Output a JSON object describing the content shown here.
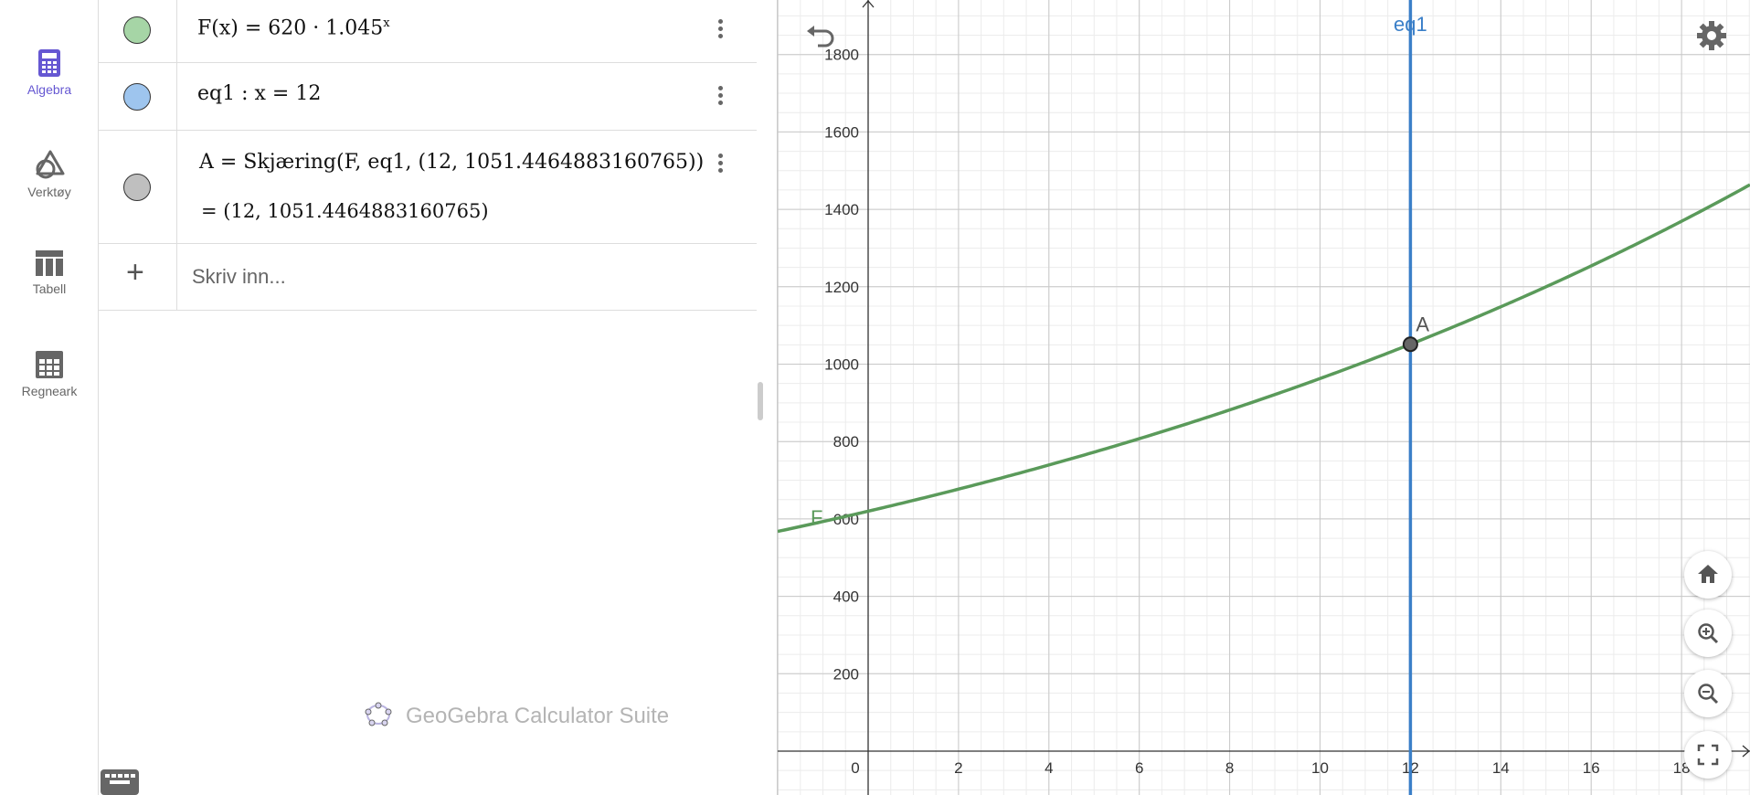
{
  "rail": {
    "items": [
      {
        "label": "Algebra",
        "icon": "calculator-icon",
        "active": true
      },
      {
        "label": "Verktøy",
        "icon": "tools-icon",
        "active": false
      },
      {
        "label": "Tabell",
        "icon": "table-icon",
        "active": false
      },
      {
        "label": "Regneark",
        "icon": "spreadsheet-icon",
        "active": false
      }
    ]
  },
  "algebra": {
    "rows": [
      {
        "text": "F(x)  =  620 · 1.045",
        "sup": "x",
        "color": "#a6d5a6"
      },
      {
        "text": "eq1 : x  =  12",
        "color": "#9ec5ee"
      },
      {
        "text": "A  =  Skjæring(F, eq1, (12,  1051.4464883160765))",
        "output": "=  (12,  1051.4464883160765)",
        "color": "#bfbfbf"
      }
    ],
    "input_placeholder": "Skriv inn..."
  },
  "brand": {
    "text": "GeoGebra Calculator Suite"
  },
  "graph": {
    "function_label": "F",
    "line_label": "eq1",
    "point_label": "A",
    "x_ticks": [
      "0",
      "2",
      "4",
      "6",
      "8",
      "10",
      "12",
      "14",
      "16",
      "18"
    ],
    "y_ticks": [
      "200",
      "400",
      "600",
      "800",
      "1000",
      "1200",
      "1400",
      "1600",
      "1800"
    ],
    "curve_color": "#5a9a5a",
    "line_color": "#3a7fc8",
    "function": {
      "a": 620,
      "b": 1.045
    },
    "vertical_line_x": 12,
    "point": {
      "x": 12,
      "y": 1051.4464883160765
    }
  },
  "buttons": [
    "undo-icon",
    "settings-icon",
    "home-icon",
    "zoom-in-icon",
    "zoom-out-icon",
    "fullscreen-icon",
    "keyboard-icon"
  ]
}
